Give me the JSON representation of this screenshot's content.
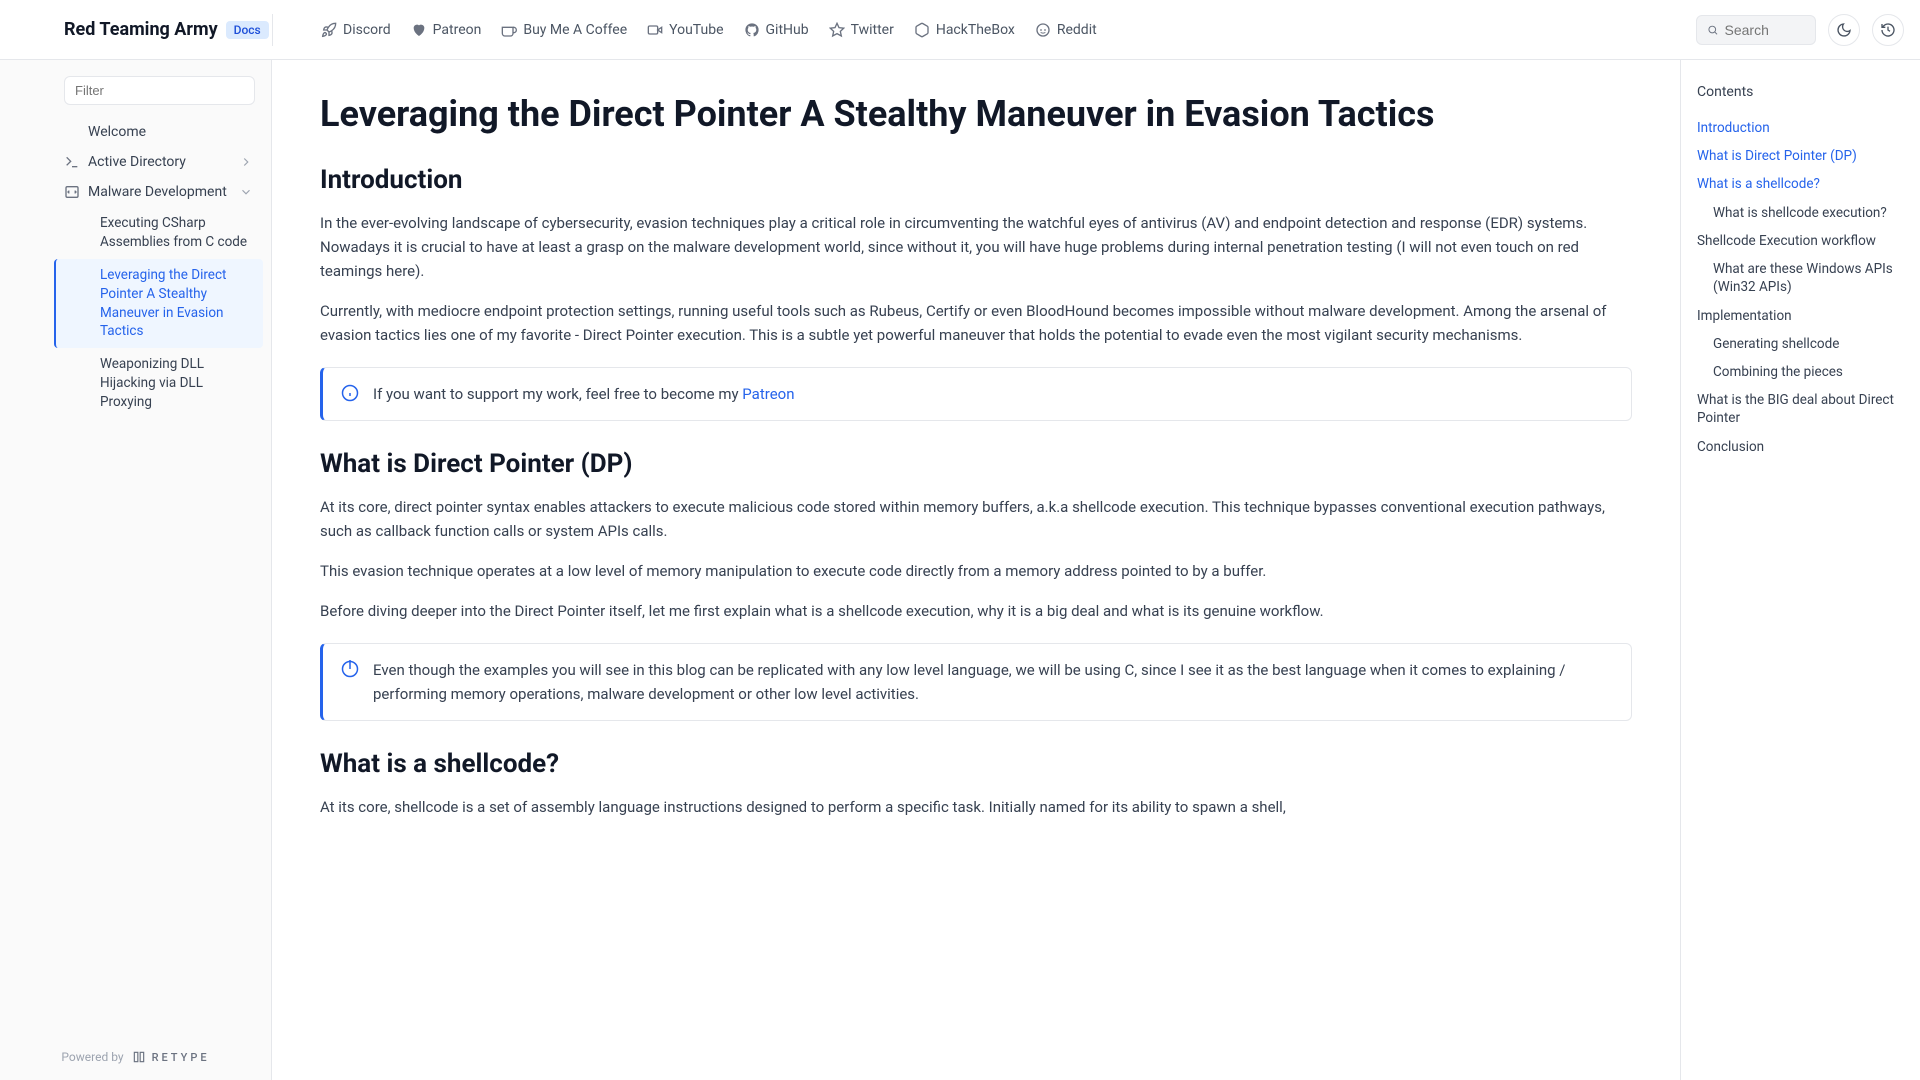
{
  "header": {
    "brand": "Red Teaming Army",
    "badge": "Docs",
    "nav": [
      {
        "label": "Discord"
      },
      {
        "label": "Patreon"
      },
      {
        "label": "Buy Me A Coffee"
      },
      {
        "label": "YouTube"
      },
      {
        "label": "GitHub"
      },
      {
        "label": "Twitter"
      },
      {
        "label": "HackTheBox"
      },
      {
        "label": "Reddit"
      }
    ],
    "search_placeholder": "Search"
  },
  "sidebar": {
    "filter_placeholder": "Filter",
    "welcome": "Welcome",
    "categories": [
      {
        "label": "Active Directory"
      },
      {
        "label": "Malware Development"
      }
    ],
    "subitems": [
      "Executing CSharp Assemblies from C code",
      "Leveraging the Direct Pointer A Stealthy Maneuver in Evasion Tactics",
      "Weaponizing DLL Hijacking via DLL Proxying"
    ],
    "powered_by": "Powered by",
    "retype": "RETYPE"
  },
  "article": {
    "title": "Leveraging the Direct Pointer A Stealthy Maneuver in Evasion Tactics",
    "h_intro": "Introduction",
    "p1": "In the ever-evolving landscape of cybersecurity, evasion techniques play a critical role in circumventing the watchful eyes of antivirus (AV) and endpoint detection and response (EDR) systems. Nowadays it is crucial to have at least a grasp on the malware development world, since without it, you will have huge problems during internal penetration testing (I will not even touch on red teamings here).",
    "p2": "Currently, with mediocre endpoint protection settings, running useful tools such as Rubeus, Certify or even BloodHound becomes impossible without malware development. Among the arsenal of evasion tactics lies one of my favorite - Direct Pointer execution. This is a subtle yet powerful maneuver that holds the potential to evade even the most vigilant security mechanisms.",
    "callout1_pre": "If you want to support my work, feel free to become my ",
    "callout1_link": "Patreon",
    "h_dp": "What is Direct Pointer (DP)",
    "p3": "At its core, direct pointer syntax enables attackers to execute malicious code stored within memory buffers, a.k.a shellcode execution. This technique bypasses conventional execution pathways, such as callback function calls or system APIs calls.",
    "p4": "This evasion technique operates at a low level of memory manipulation to execute code directly from a memory address pointed to by a buffer.",
    "p5": "Before diving deeper into the Direct Pointer itself, let me first explain what is a shellcode execution, why it is a big deal and what is its genuine workflow.",
    "callout2": "Even though the examples you will see in this blog can be replicated with any low level language, we will be using C, since I see it as the best language when it comes to explaining / performing memory operations, malware development or other low level activities.",
    "h_sc": "What is a shellcode?",
    "p6": "At its core, shellcode is a set of assembly language instructions designed to perform a specific task. Initially named for its ability to spawn a shell,"
  },
  "toc": {
    "title": "Contents",
    "items": [
      {
        "label": "Introduction",
        "level": 1,
        "active": true
      },
      {
        "label": "What is Direct Pointer (DP)",
        "level": 1,
        "active": true
      },
      {
        "label": "What is a shellcode?",
        "level": 1,
        "active": true
      },
      {
        "label": "What is shellcode execution?",
        "level": 2,
        "active": false
      },
      {
        "label": "Shellcode Execution workflow",
        "level": 1,
        "active": false
      },
      {
        "label": "What are these Windows APIs (Win32 APIs)",
        "level": 2,
        "active": false
      },
      {
        "label": "Implementation",
        "level": 1,
        "active": false
      },
      {
        "label": "Generating shellcode",
        "level": 2,
        "active": false
      },
      {
        "label": "Combining the pieces",
        "level": 2,
        "active": false
      },
      {
        "label": "What is the BIG deal about Direct Pointer",
        "level": 1,
        "active": false
      },
      {
        "label": "Conclusion",
        "level": 1,
        "active": false
      }
    ]
  }
}
